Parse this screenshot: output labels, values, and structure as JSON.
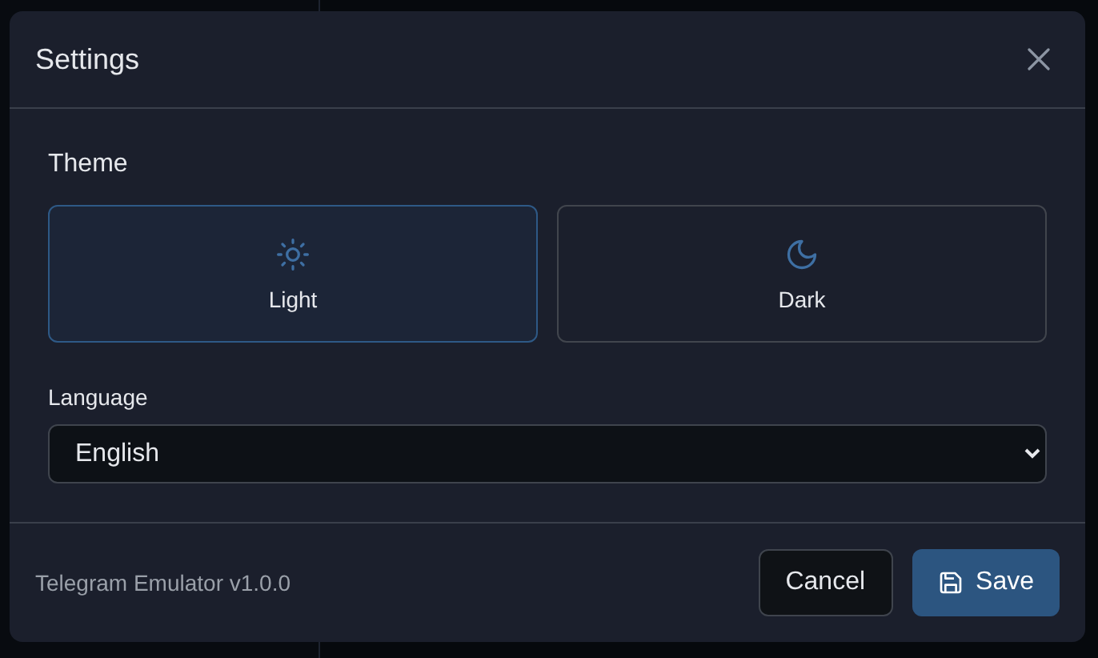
{
  "dialog": {
    "title": "Settings"
  },
  "theme": {
    "label": "Theme",
    "options": [
      {
        "label": "Light",
        "kind": "sun",
        "selected": true
      },
      {
        "label": "Dark",
        "kind": "moon",
        "selected": false
      }
    ]
  },
  "language": {
    "label": "Language",
    "value": "English"
  },
  "footer": {
    "version": "Telegram Emulator v1.0.0",
    "buttons": [
      {
        "label": "Cancel",
        "kind": "secondary"
      },
      {
        "label": "Save",
        "kind": "primary"
      }
    ]
  }
}
